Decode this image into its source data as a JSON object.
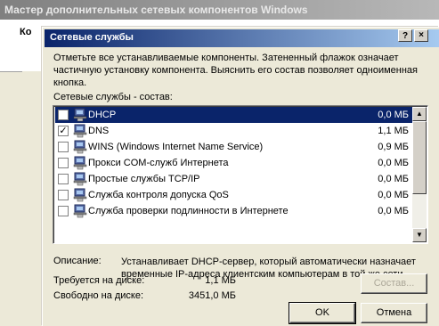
{
  "outer_window": {
    "title": "Мастер дополнительных сетевых компонентов Windows",
    "partial_label": "Ко"
  },
  "dialog": {
    "title": "Сетевые службы",
    "help_button": "?",
    "close_button": "×",
    "instructions": "Отметьте все устанавливаемые компоненты. Затененный флажок означает частичную установку компонента. Выяснить его состав позволяет одноименная кнопка.",
    "list_label": "Сетевые службы - состав:",
    "components": [
      {
        "name": "DHCP",
        "size": "0,0 МБ",
        "checked": "",
        "selected": true
      },
      {
        "name": "DNS",
        "size": "1,1 МБ",
        "checked": "✓",
        "selected": false
      },
      {
        "name": "WINS (Windows Internet Name Service)",
        "size": "0,9 МБ",
        "checked": "",
        "selected": false
      },
      {
        "name": "Прокси COM-служб Интернета",
        "size": "0,0 МБ",
        "checked": "",
        "selected": false
      },
      {
        "name": "Простые службы TCP/IP",
        "size": "0,0 МБ",
        "checked": "",
        "selected": false
      },
      {
        "name": "Служба контроля допуска QoS",
        "size": "0,0 МБ",
        "checked": "",
        "selected": false
      },
      {
        "name": "Служба проверки подлинности в Интернете",
        "size": "0,0 МБ",
        "checked": "",
        "selected": false
      }
    ],
    "scroll_up": "▲",
    "scroll_down": "▼",
    "description_label": "Описание:",
    "description_text": "Устанавливает DHCP-сервер, который автоматически назначает временные IP-адреса клиентским компьютерам в той же сети.",
    "disk_required_label": "Требуется на диске:",
    "disk_required_value": "1,1 МБ",
    "disk_free_label": "Свободно на диске:",
    "disk_free_value": "3451,0 МБ",
    "details_button": "Состав...",
    "ok_button": "OK",
    "cancel_button": "Отмена"
  },
  "colors": {
    "titlebar_active": "#0a246a",
    "titlebar_inactive": "#808080",
    "dialog_bg": "#ece9d8",
    "selection": "#0a246a"
  }
}
